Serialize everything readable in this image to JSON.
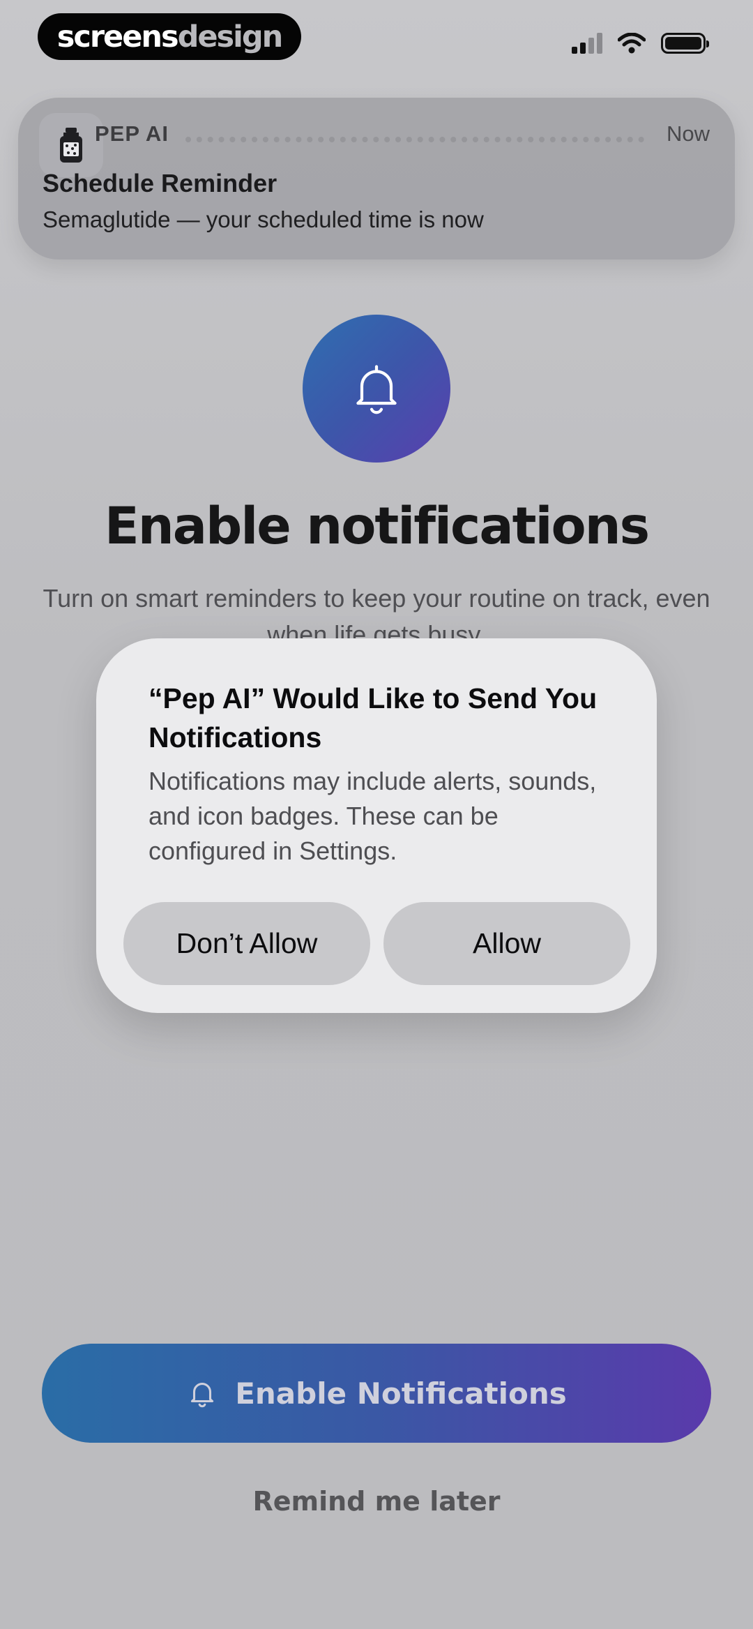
{
  "status_bar": {
    "brand_part1": "screens",
    "brand_part2": "design",
    "icons": [
      "cellular-signal-icon",
      "wifi-icon",
      "battery-icon"
    ]
  },
  "banner": {
    "app_name": "PEP AI",
    "time": "Now",
    "title": "Schedule Reminder",
    "body": "Semaglutide — your scheduled time is now",
    "icon": "medicine-bottle-icon"
  },
  "hero": {
    "icon": "bell-icon",
    "headline": "Enable notifications",
    "subtext": "Turn on smart reminders to keep your routine on track, even when life gets busy."
  },
  "dialog": {
    "title": "“Pep AI” Would Like to Send You Notifications",
    "body": "Notifications may include alerts, sounds, and icon badges. These can be configured in Settings.",
    "deny_label": "Don’t Allow",
    "allow_label": "Allow"
  },
  "actions": {
    "enable_label": "Enable Notifications",
    "later_label": "Remind me later"
  },
  "colors": {
    "gradient_start": "#2a6da6",
    "gradient_end": "#5a3aab",
    "dialog_bg": "#ebebed",
    "dialog_button_bg": "#c8c8cb"
  }
}
